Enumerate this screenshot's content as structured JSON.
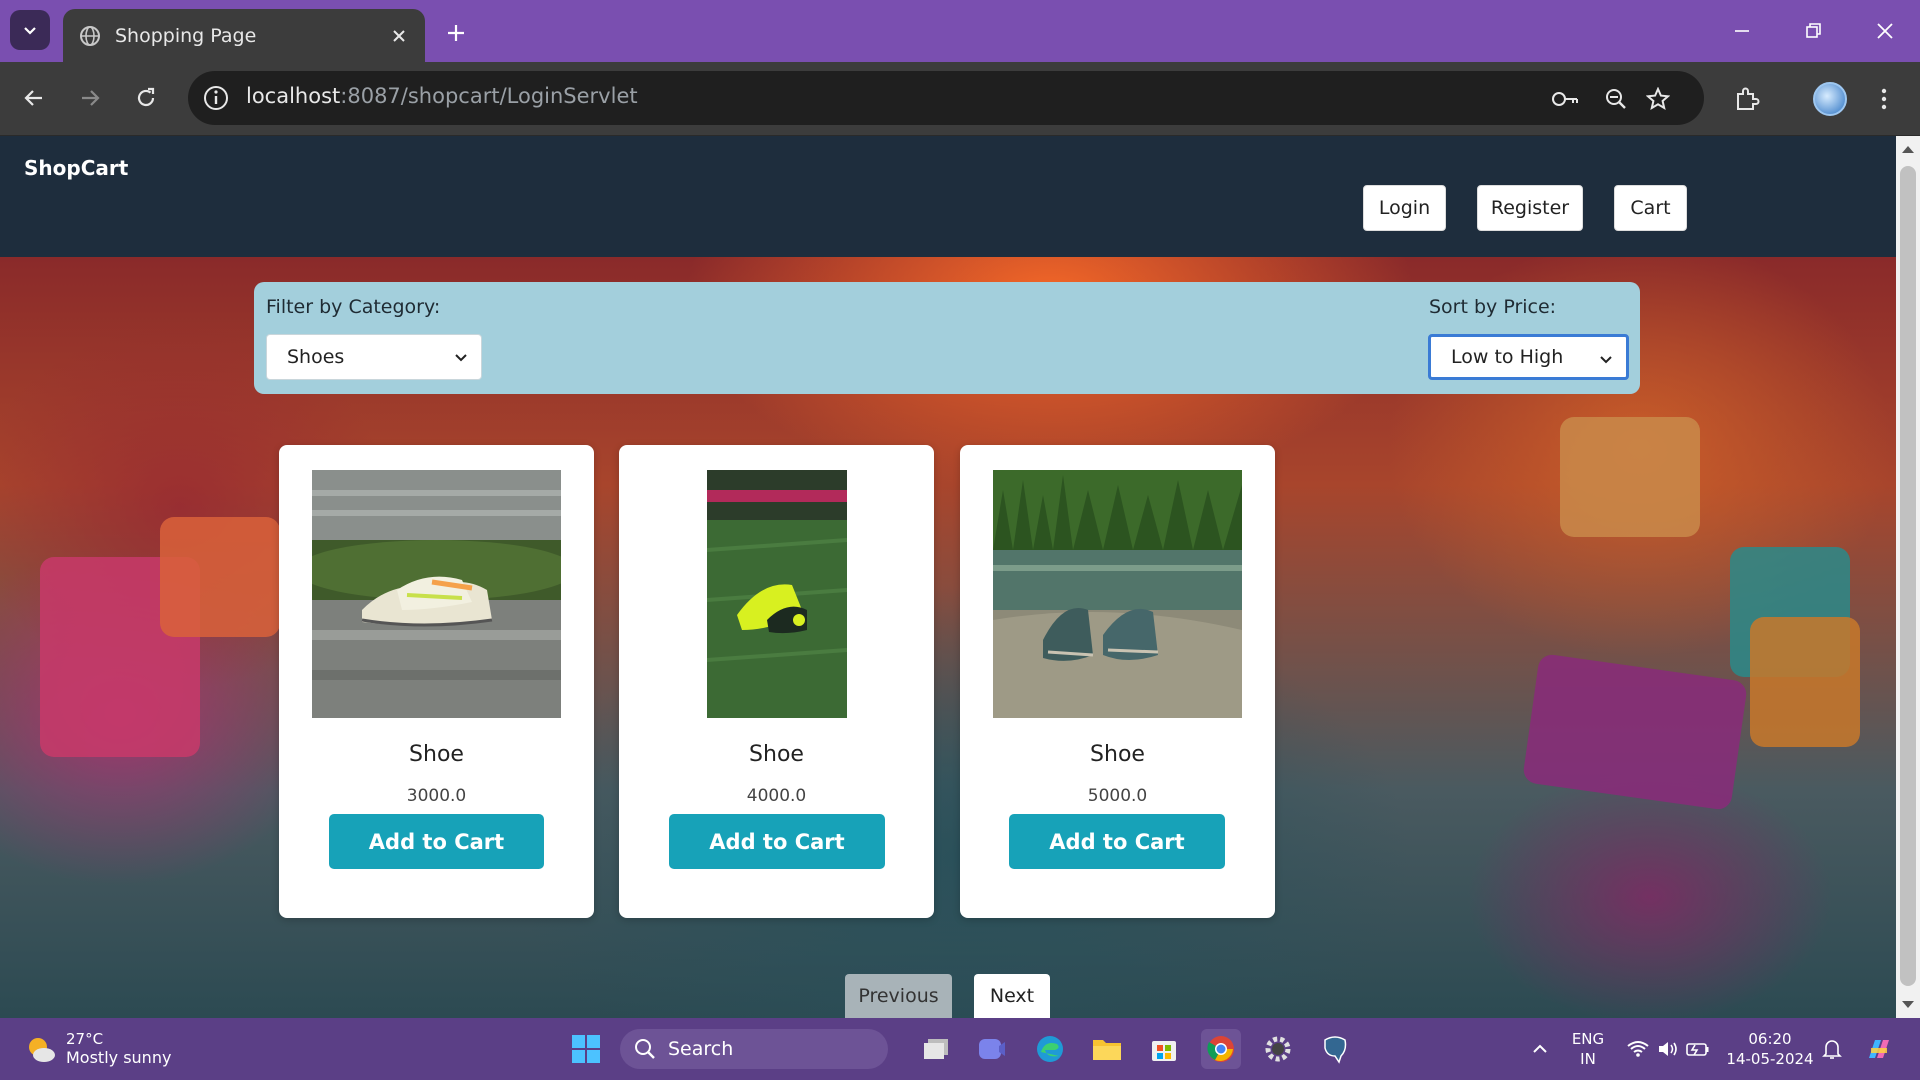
{
  "browser": {
    "tab_title": "Shopping Page",
    "url_host": "localhost",
    "url_path": ":8087/shopcart/LoginServlet"
  },
  "header": {
    "brand": "ShopCart",
    "login_label": "Login",
    "register_label": "Register",
    "cart_label": "Cart"
  },
  "filters": {
    "category_label": "Filter by Category:",
    "category_value": "Shoes",
    "sort_label": "Sort by Price:",
    "sort_value": "Low to High"
  },
  "products": [
    {
      "name": "Shoe",
      "price": "3000.0",
      "button": "Add to Cart"
    },
    {
      "name": "Shoe",
      "price": "4000.0",
      "button": "Add to Cart"
    },
    {
      "name": "Shoe",
      "price": "5000.0",
      "button": "Add to Cart"
    }
  ],
  "pagination": {
    "previous_label": "Previous",
    "next_label": "Next"
  },
  "taskbar": {
    "weather_temp": "27°C",
    "weather_condition": "Mostly sunny",
    "search_label": "Search",
    "lang_top": "ENG",
    "lang_bottom": "IN",
    "time": "06:20",
    "date": "14-05-2024"
  },
  "colors": {
    "tabbar": "#7a4fb0",
    "header": "#1e2d3d",
    "filter_bar": "#a3cfdc",
    "add_button": "#17a2b8",
    "taskbar": "#5b3f86"
  }
}
